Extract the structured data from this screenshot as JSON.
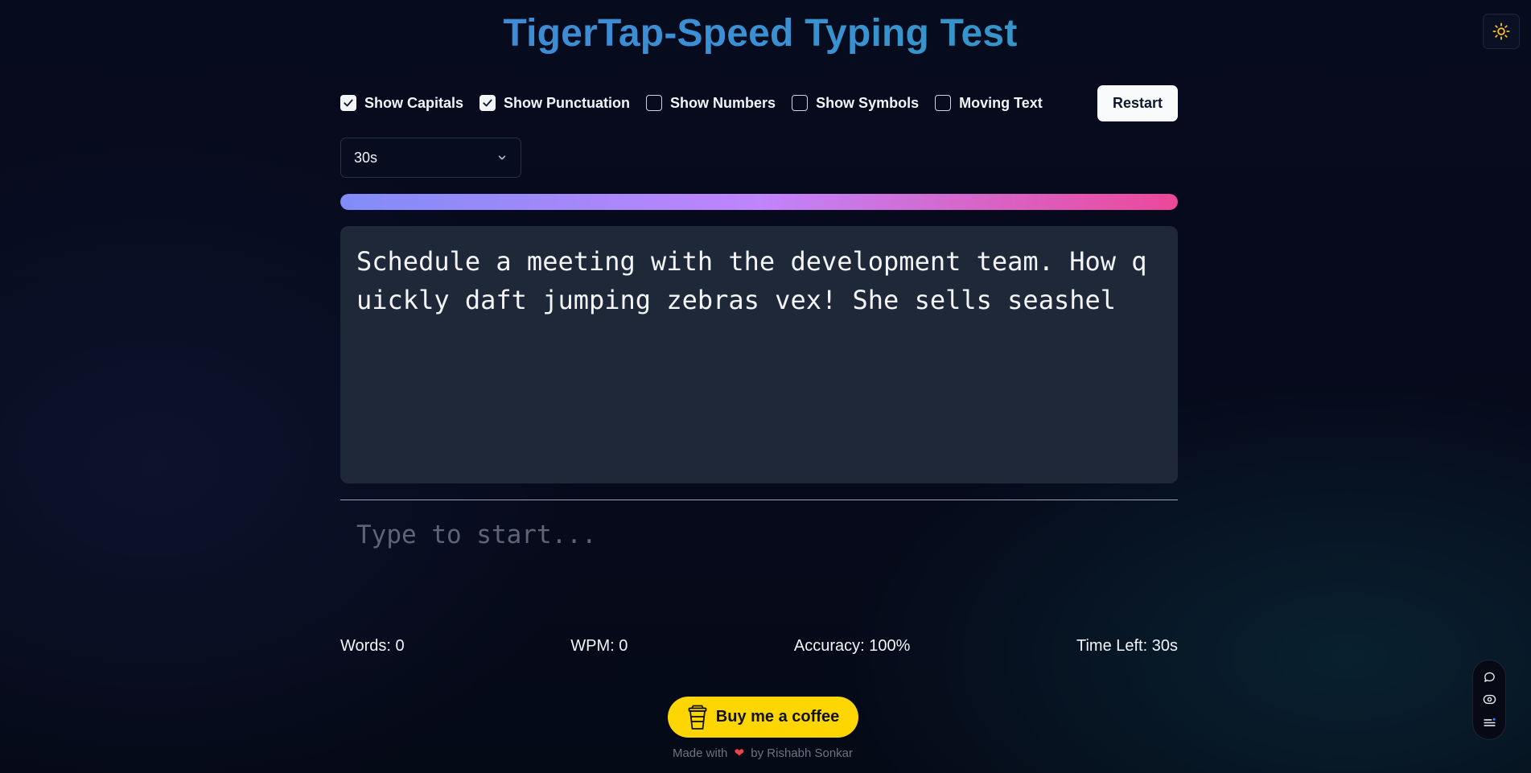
{
  "app": {
    "title": "TigerTap-Speed Typing Test"
  },
  "options": [
    {
      "label": "Show Capitals",
      "checked": true
    },
    {
      "label": "Show Punctuation",
      "checked": true
    },
    {
      "label": "Show Numbers",
      "checked": false
    },
    {
      "label": "Show Symbols",
      "checked": false
    },
    {
      "label": "Moving Text",
      "checked": false
    }
  ],
  "restart_label": "Restart",
  "duration_select": {
    "value": "30s"
  },
  "progress": {
    "fraction": 1.0
  },
  "typing_text": "Schedule a meeting with the development team. How quickly daft jumping zebras vex! She sells seashel",
  "input": {
    "placeholder": "Type to start..."
  },
  "stats": {
    "words": "Words: 0",
    "wpm": "WPM: 0",
    "accuracy": "Accuracy: 100%",
    "time_left": "Time Left: 30s"
  },
  "coffee_label": "Buy me a coffee",
  "footer": {
    "prefix": "Made with",
    "suffix": "by Rishabh Sonkar"
  },
  "icons": {
    "theme_toggle": "sun-icon",
    "coffee": "coffee-cup-icon",
    "heart": "heart-icon",
    "toolbar": [
      "chat-icon",
      "eye-icon",
      "menu-icon"
    ]
  },
  "colors": {
    "accent_title_start": "#4a7fd6",
    "accent_title_end": "#2aa0b8",
    "sun": "#fbbf24",
    "coffee_bg": "#fdd600",
    "progress_start": "#818cf8",
    "progress_end": "#ec4899"
  }
}
